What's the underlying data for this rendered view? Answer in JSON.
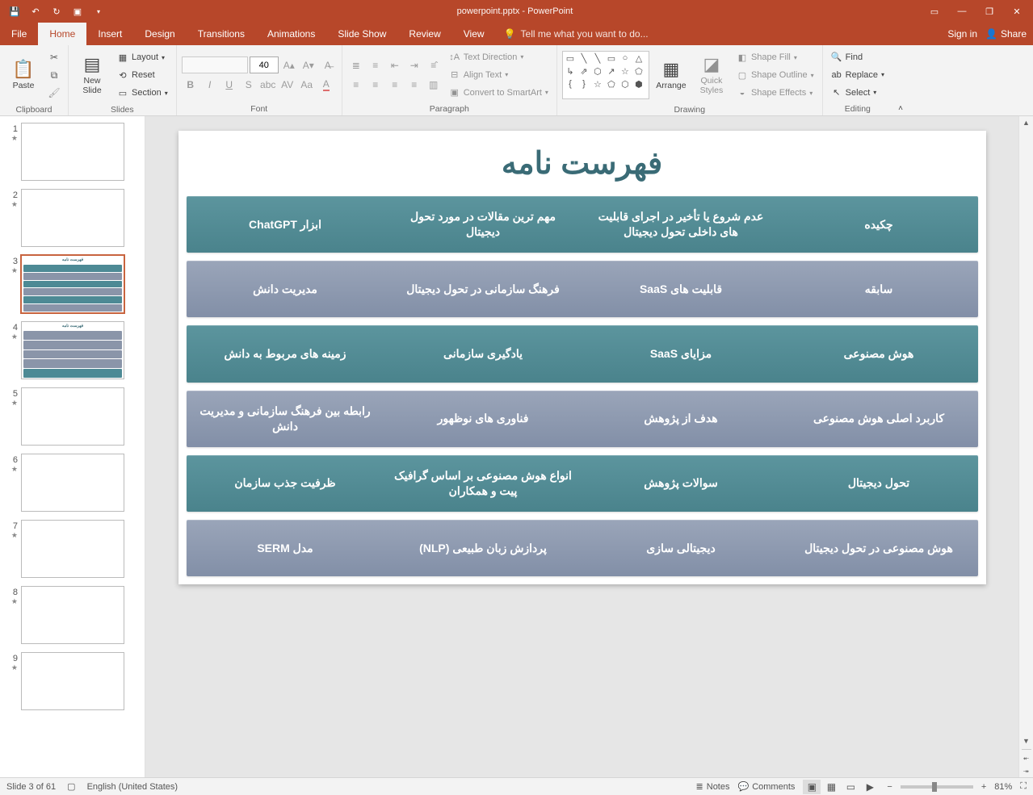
{
  "app": {
    "title": "powerpoint.pptx - PowerPoint",
    "signin": "Sign in",
    "share": "Share"
  },
  "tabs": {
    "file": "File",
    "home": "Home",
    "insert": "Insert",
    "design": "Design",
    "transitions": "Transitions",
    "animations": "Animations",
    "slideshow": "Slide Show",
    "review": "Review",
    "view": "View",
    "tellme_placeholder": "Tell me what you want to do..."
  },
  "ribbon": {
    "clipboard": {
      "label": "Clipboard",
      "paste": "Paste"
    },
    "slides": {
      "label": "Slides",
      "new_slide": "New\nSlide",
      "layout": "Layout",
      "reset": "Reset",
      "section": "Section"
    },
    "font": {
      "label": "Font",
      "size": "40"
    },
    "paragraph": {
      "label": "Paragraph",
      "text_direction": "Text Direction",
      "align_text": "Align Text",
      "smartart": "Convert to SmartArt"
    },
    "drawing": {
      "label": "Drawing",
      "arrange": "Arrange",
      "quick_styles": "Quick\nStyles",
      "shape_fill": "Shape Fill",
      "shape_outline": "Shape Outline",
      "shape_effects": "Shape Effects"
    },
    "editing": {
      "label": "Editing",
      "find": "Find",
      "replace": "Replace",
      "select": "Select"
    }
  },
  "slide": {
    "title": "فهرست نامه",
    "rows": [
      {
        "style": "a",
        "cells": [
          "چکیده",
          "عدم شروع یا تأخیر در اجرای قابلیت های داخلی تحول دیجیتال",
          "مهم ترین مقالات در مورد تحول دیجیتال",
          "ابزار ChatGPT"
        ]
      },
      {
        "style": "b",
        "cells": [
          "سابقه",
          "قابلیت های SaaS",
          "فرهنگ سازمانی در تحول دیجیتال",
          "مدیریت دانش"
        ]
      },
      {
        "style": "a",
        "cells": [
          "هوش مصنوعی",
          "مزایای SaaS",
          "یادگیری سازمانی",
          "زمینه های مربوط به دانش"
        ]
      },
      {
        "style": "b",
        "cells": [
          "کاربرد اصلی هوش مصنوعی",
          "هدف از پژوهش",
          "فناوری های نوظهور",
          "رابطه بین فرهنگ سازمانی و مدیریت دانش"
        ]
      },
      {
        "style": "a",
        "cells": [
          "تحول دیجیتال",
          "سوالات پژوهش",
          "انواع هوش مصنوعی بر اساس گرافیک پیت و همکاران",
          "ظرفیت جذب سازمان"
        ]
      },
      {
        "style": "b",
        "cells": [
          "هوش مصنوعی در تحول دیجیتال",
          "دیجیتالی سازی",
          "پردازش زبان طبیعی (NLP)",
          "مدل SERM"
        ]
      }
    ]
  },
  "thumbs": {
    "total": 9,
    "toc_title": "فهرست نامه"
  },
  "status": {
    "slide_of": "Slide 3 of 61",
    "language": "English (United States)",
    "notes": "Notes",
    "comments": "Comments",
    "zoom": "81%"
  }
}
